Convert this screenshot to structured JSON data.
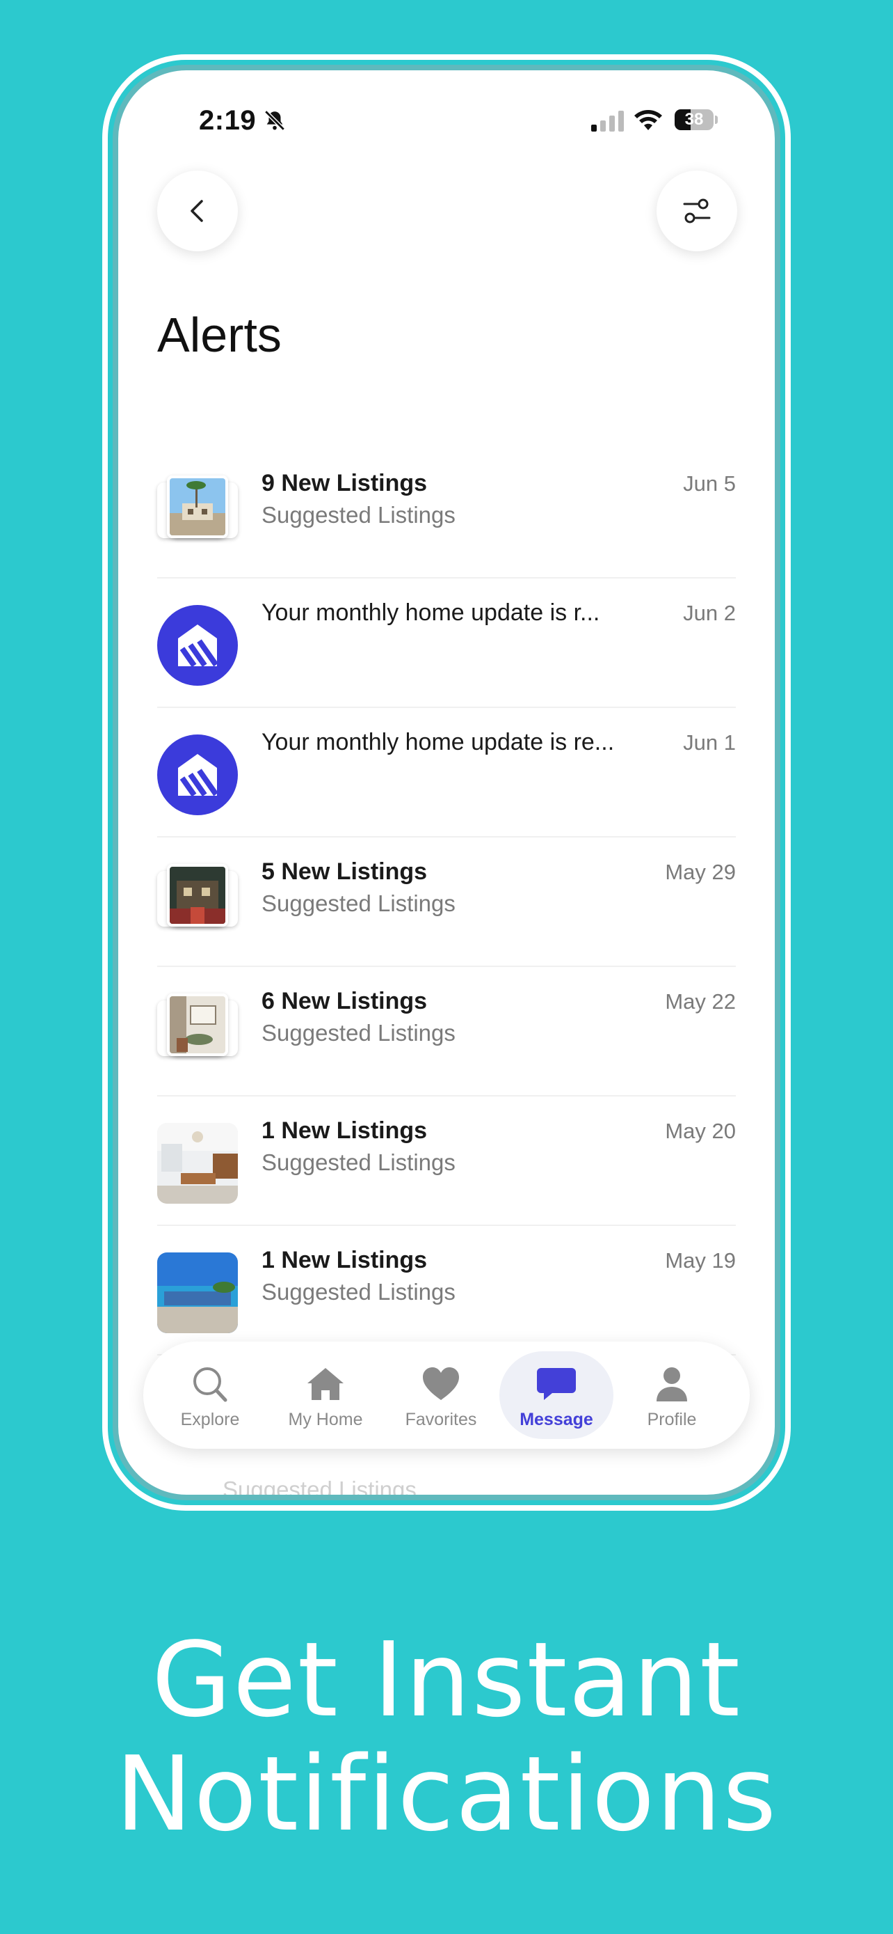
{
  "status_bar": {
    "time": "2:19",
    "battery": "38"
  },
  "header": {
    "title": "Alerts"
  },
  "alerts": [
    {
      "title": "9 New Listings",
      "subtitle": "Suggested Listings",
      "date": "Jun 5"
    },
    {
      "title": "Your monthly home update is r...",
      "subtitle": "",
      "date": "Jun 2"
    },
    {
      "title": "Your monthly home update is re...",
      "subtitle": "",
      "date": "Jun 1"
    },
    {
      "title": "5 New Listings",
      "subtitle": "Suggested Listings",
      "date": "May 29"
    },
    {
      "title": "6 New Listings",
      "subtitle": "Suggested Listings",
      "date": "May 22"
    },
    {
      "title": "1 New Listings",
      "subtitle": "Suggested Listings",
      "date": "May 20"
    },
    {
      "title": "1 New Listings",
      "subtitle": "Suggested Listings",
      "date": "May 19"
    }
  ],
  "ghost_text": "Suggested Listings",
  "nav": {
    "tabs": [
      {
        "label": "Explore",
        "icon": "search-icon"
      },
      {
        "label": "My Home",
        "icon": "home-icon"
      },
      {
        "label": "Favorites",
        "icon": "heart-icon"
      },
      {
        "label": "Message",
        "icon": "message-icon",
        "active": true
      },
      {
        "label": "Profile",
        "icon": "person-icon"
      }
    ]
  },
  "tagline": {
    "line1": "Get Instant",
    "line2": "Notifications"
  },
  "colors": {
    "background": "#2cc9ce",
    "accent": "#3b3bdb"
  }
}
